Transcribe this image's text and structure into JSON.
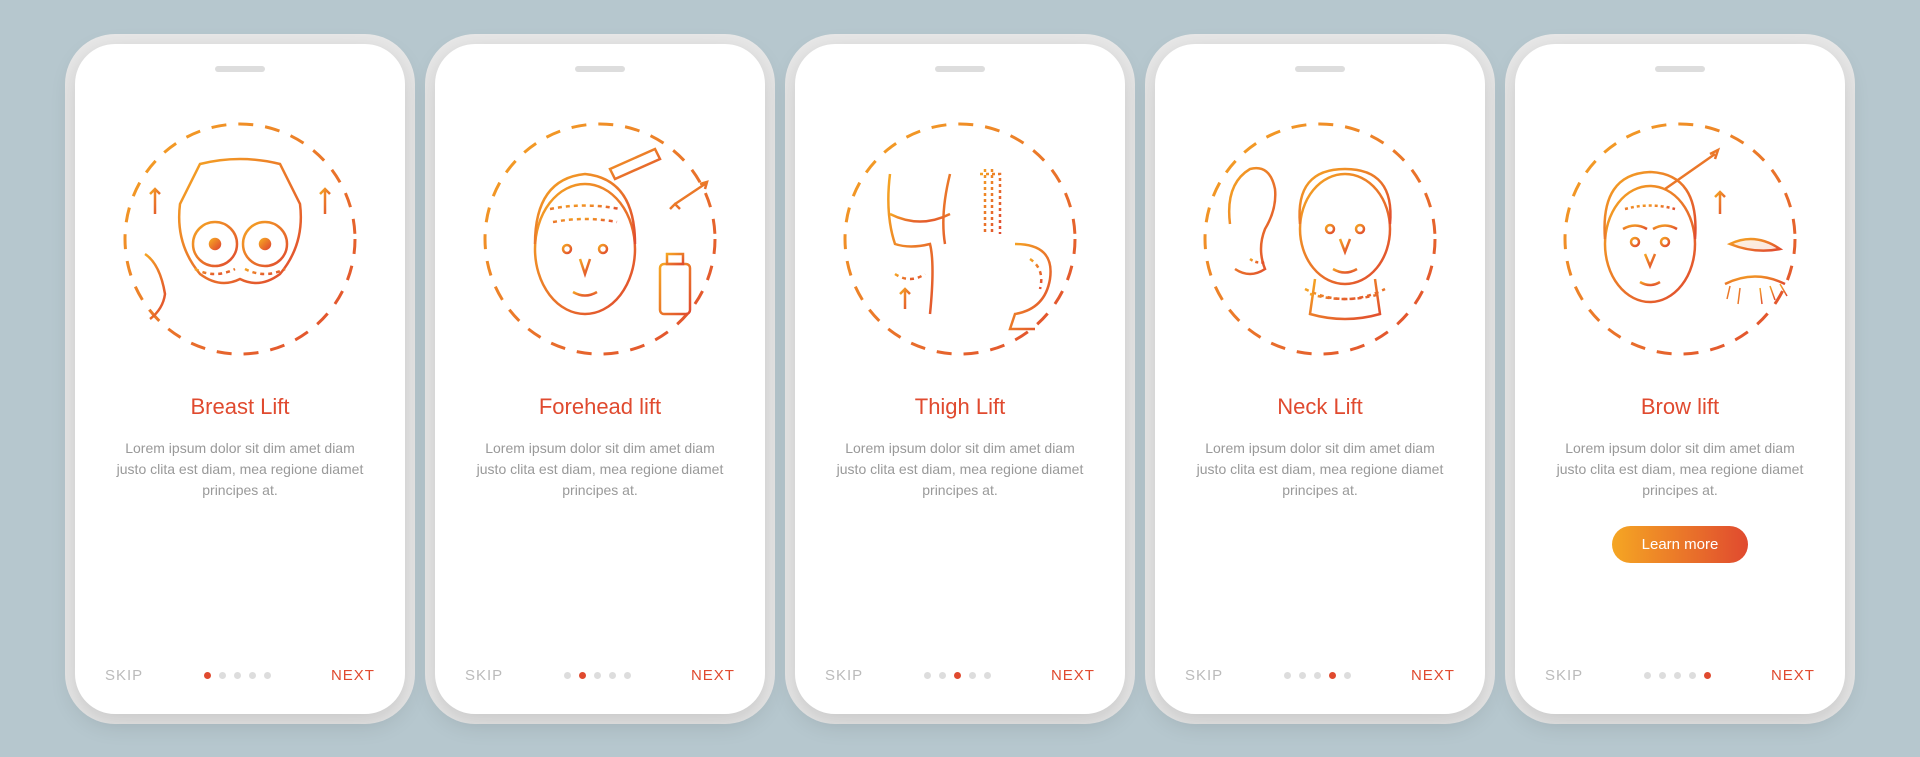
{
  "common": {
    "skip_label": "SKIP",
    "next_label": "NEXT",
    "description": "Lorem ipsum dolor sit dim amet diam justo clita est diam, mea regione diamet principes at.",
    "learn_more_label": "Learn more",
    "colors": {
      "gradient_start": "#f5a623",
      "gradient_end": "#e04a2f",
      "accent": "#e04a2f"
    }
  },
  "screens": [
    {
      "title": "Breast Lift",
      "icon": "breast-lift-icon",
      "active_dot": 0,
      "cta": false
    },
    {
      "title": "Forehead lift",
      "icon": "forehead-lift-icon",
      "active_dot": 1,
      "cta": false
    },
    {
      "title": "Thigh Lift",
      "icon": "thigh-lift-icon",
      "active_dot": 2,
      "cta": false
    },
    {
      "title": "Neck Lift",
      "icon": "neck-lift-icon",
      "active_dot": 3,
      "cta": false
    },
    {
      "title": "Brow lift",
      "icon": "brow-lift-icon",
      "active_dot": 4,
      "cta": true
    }
  ]
}
